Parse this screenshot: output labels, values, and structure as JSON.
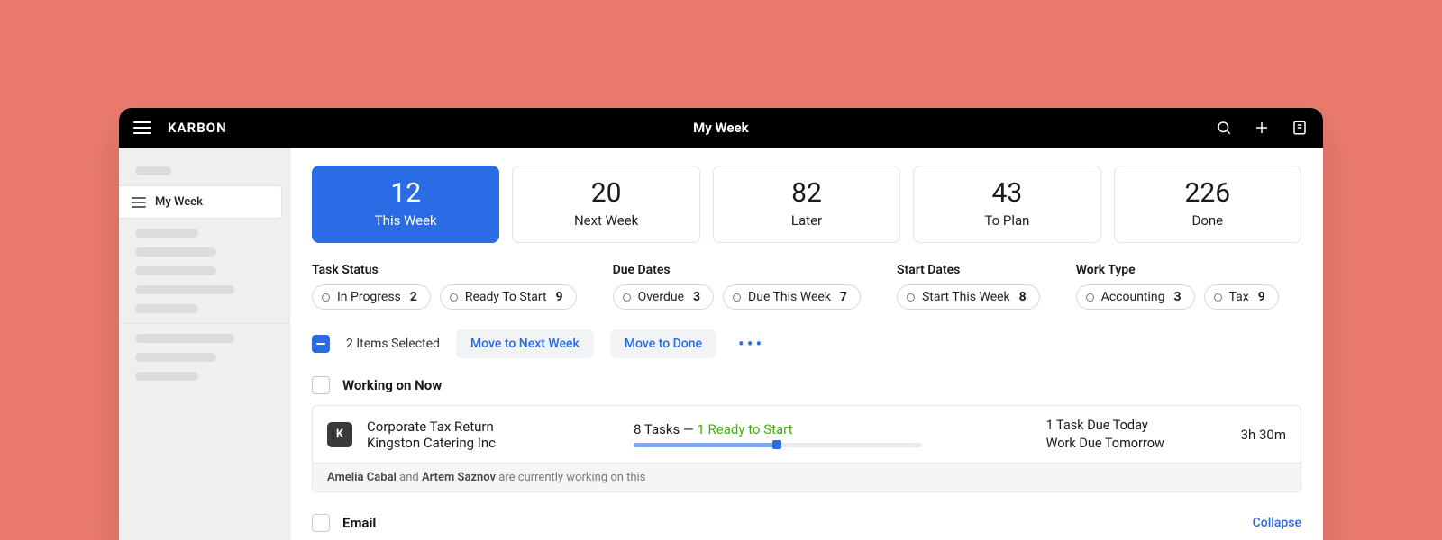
{
  "topbar": {
    "brand": "KARBON",
    "title": "My Week"
  },
  "sidebar": {
    "active_label": "My Week"
  },
  "stats": [
    {
      "count": "12",
      "label": "This Week",
      "active": true
    },
    {
      "count": "20",
      "label": "Next Week",
      "active": false
    },
    {
      "count": "82",
      "label": "Later",
      "active": false
    },
    {
      "count": "43",
      "label": "To Plan",
      "active": false
    },
    {
      "count": "226",
      "label": "Done",
      "active": false
    }
  ],
  "filters": {
    "task_status": {
      "title": "Task Status",
      "chips": [
        {
          "label": "In Progress",
          "count": "2"
        },
        {
          "label": "Ready To Start",
          "count": "9"
        }
      ]
    },
    "due_dates": {
      "title": "Due Dates",
      "chips": [
        {
          "label": "Overdue",
          "count": "3"
        },
        {
          "label": "Due This Week",
          "count": "7"
        }
      ]
    },
    "start_dates": {
      "title": "Start Dates",
      "chips": [
        {
          "label": "Start This Week",
          "count": "8"
        }
      ]
    },
    "work_type": {
      "title": "Work Type",
      "chips": [
        {
          "label": "Accounting",
          "count": "3"
        },
        {
          "label": "Tax",
          "count": "9"
        }
      ]
    }
  },
  "bulk": {
    "selected_text": "2 Items Selected",
    "move_next": "Move to Next Week",
    "move_done": "Move to Done"
  },
  "sections": {
    "working_now": {
      "title": "Working on Now"
    },
    "email": {
      "title": "Email",
      "collapse": "Collapse"
    }
  },
  "work_item": {
    "avatar_letter": "K",
    "name": "Corporate Tax Return",
    "client": "Kingston Catering Inc",
    "tasks_summary_prefix": "8 Tasks",
    "tasks_summary_dash": " — ",
    "tasks_summary_ready": "1 Ready to Start",
    "due_line1": "1 Task Due Today",
    "due_line2": "Work Due Tomorrow",
    "time": "3h 30m",
    "footer_name1": "Amelia Cabal",
    "footer_and": " and ",
    "footer_name2": "Artem Saznov",
    "footer_suffix": " are currently working on this"
  }
}
